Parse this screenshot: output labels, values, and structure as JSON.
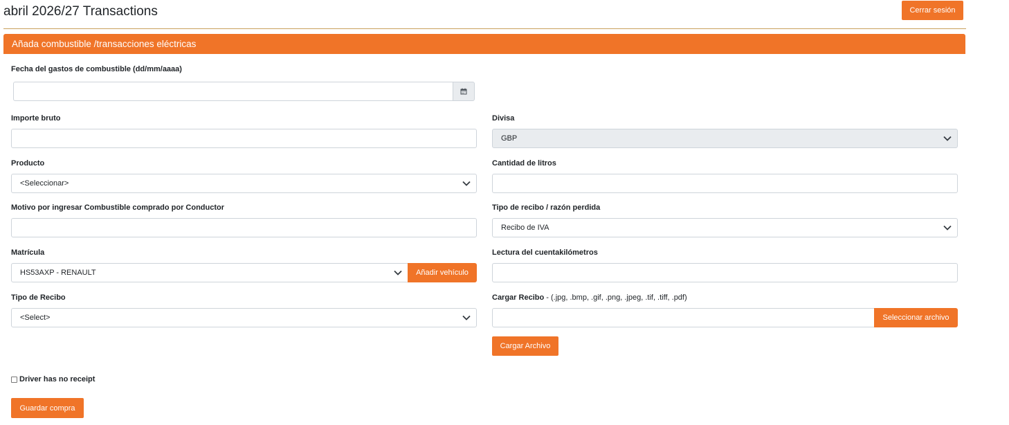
{
  "header": {
    "title": "abril 2026/27 Transactions",
    "logout_label": "Cerrar sesión"
  },
  "panel": {
    "heading": "Añada combustible /transacciones eléctricas"
  },
  "form": {
    "date": {
      "label": "Fecha del gastos de combustible (dd/mm/aaaa)",
      "value": "",
      "icon": "calendar-icon"
    },
    "gross_amount": {
      "label": "Importe bruto",
      "value": ""
    },
    "currency": {
      "label": "Divisa",
      "selected": "GBP",
      "disabled": true
    },
    "product": {
      "label": "Producto",
      "selected": "<Seleccionar>"
    },
    "litres": {
      "label": "Cantidad de litros",
      "value": ""
    },
    "reason": {
      "label": "Motivo por ingresar Combustible comprado por Conductor",
      "value": ""
    },
    "receipt_reason": {
      "label": "Tipo de recibo / razón perdida",
      "selected": "Recibo de IVA"
    },
    "registration": {
      "label": "Matrícula",
      "selected": "HS53AXP - RENAULT",
      "add_vehicle_label": "Añadir vehículo"
    },
    "odometer": {
      "label": "Lectura del cuentakilómetros",
      "value": ""
    },
    "receipt_type": {
      "label": "Tipo de Recibo",
      "selected": "<Select>"
    },
    "upload": {
      "label": "Cargar Recibo",
      "hint": " - (.jpg, .bmp, .gif, .png, .jpeg, .tif, .tiff, .pdf)",
      "value": "",
      "select_file_label": "Seleccionar archivo",
      "upload_label": "Cargar Archivo"
    },
    "no_receipt": {
      "label": "Driver has no receipt",
      "checked": false
    },
    "save_label": "Guardar compra"
  },
  "colors": {
    "accent": "#f07428",
    "rule": "#c8a05a",
    "disabled_bg": "#e9ecef"
  }
}
